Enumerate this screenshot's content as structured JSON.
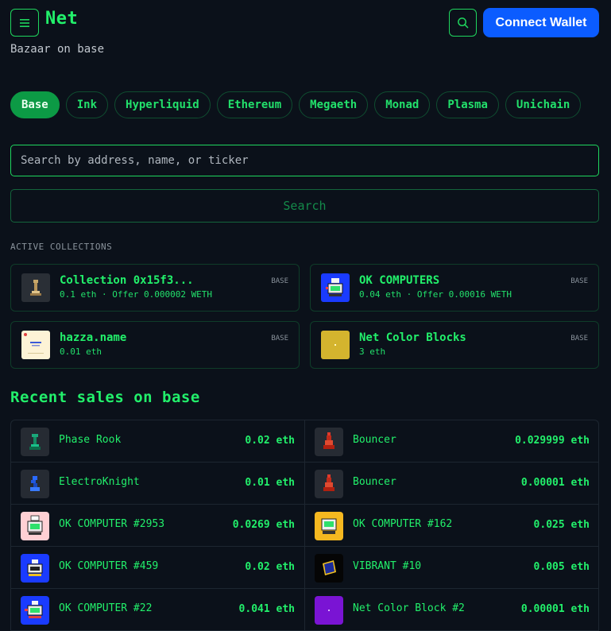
{
  "header": {
    "logo": "Net",
    "tagline": "Bazaar on base",
    "connect_label": "Connect Wallet"
  },
  "chains": [
    {
      "label": "Base",
      "active": true
    },
    {
      "label": "Ink",
      "active": false
    },
    {
      "label": "Hyperliquid",
      "active": false
    },
    {
      "label": "Ethereum",
      "active": false
    },
    {
      "label": "Megaeth",
      "active": false
    },
    {
      "label": "Monad",
      "active": false
    },
    {
      "label": "Plasma",
      "active": false
    },
    {
      "label": "Unichain",
      "active": false
    }
  ],
  "search": {
    "placeholder": "Search by address, name, or ticker",
    "button_label": "Search"
  },
  "collections_label": "ACTIVE COLLECTIONS",
  "collections": [
    {
      "name": "Collection 0x15f3...",
      "meta": "0.1 eth · Offer 0.000002 WETH",
      "chain": "BASE",
      "icon": "rook-icon"
    },
    {
      "name": "OK COMPUTERS",
      "meta": "0.04 eth · Offer 0.00016 WETH",
      "chain": "BASE",
      "icon": "computer-icon"
    },
    {
      "name": "hazza.name",
      "meta": "0.01 eth",
      "chain": "BASE",
      "icon": "name-card-icon"
    },
    {
      "name": "Net Color Blocks",
      "meta": "3 eth",
      "chain": "BASE",
      "icon": "color-block-icon"
    }
  ],
  "recent_title": "Recent sales on base",
  "sales_left": [
    {
      "name": "Phase Rook",
      "price": "0.02 eth",
      "icon": "rook-icon"
    },
    {
      "name": "ElectroKnight",
      "price": "0.01 eth",
      "icon": "knight-icon"
    },
    {
      "name": "OK COMPUTER #2953",
      "price": "0.0269 eth",
      "icon": "computer-icon"
    },
    {
      "name": "OK COMPUTER #459",
      "price": "0.02 eth",
      "icon": "computer-icon"
    },
    {
      "name": "OK COMPUTER #22",
      "price": "0.041 eth",
      "icon": "computer-icon"
    }
  ],
  "sales_right": [
    {
      "name": "Bouncer",
      "price": "0.029999 eth",
      "icon": "bouncer-icon"
    },
    {
      "name": "Bouncer",
      "price": "0.00001 eth",
      "icon": "bouncer-icon"
    },
    {
      "name": "OK COMPUTER #162",
      "price": "0.025 eth",
      "icon": "computer-icon"
    },
    {
      "name": "VIBRANT #10",
      "price": "0.005 eth",
      "icon": "vibrant-icon"
    },
    {
      "name": "Net Color Block #2",
      "price": "0.00001 eth",
      "icon": "color-block-icon"
    }
  ],
  "colors": {
    "accent": "#22f06b",
    "background": "#0b111a",
    "connect_button": "#0b5cff",
    "active_pill": "#0c9a45"
  }
}
